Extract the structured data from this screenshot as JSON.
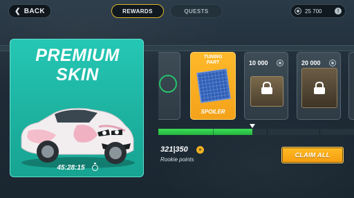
{
  "topbar": {
    "back_label": "BACK",
    "tabs": [
      {
        "label": "REWARDS",
        "active": true
      },
      {
        "label": "QUESTS",
        "active": false
      }
    ],
    "currency": {
      "amount": "25 700",
      "icon": "coin-icon"
    }
  },
  "premium_card": {
    "title_line1": "PREMIUM",
    "title_line2": "SKIN",
    "timer": "45:28:15",
    "accent": "#22bfad"
  },
  "rewards": [
    {
      "type": "completed",
      "icon": "check-icon"
    },
    {
      "type": "tuning",
      "line1": "TUNING",
      "line2": "PART",
      "item": "SPOILER",
      "accent": "#f6a41c"
    },
    {
      "type": "locked",
      "amount": "10 000",
      "icon": "lock-icon"
    },
    {
      "type": "locked",
      "amount": "20 000",
      "icon": "lock-icon"
    }
  ],
  "progress": {
    "points_text": "321|350",
    "points_label": "Rookie points",
    "fill_fraction": 0.48
  },
  "claim_all_label": "CLAIM ALL",
  "colors": {
    "gold": "#f6a41c",
    "green": "#2fcf4c",
    "background": "#22313b"
  }
}
